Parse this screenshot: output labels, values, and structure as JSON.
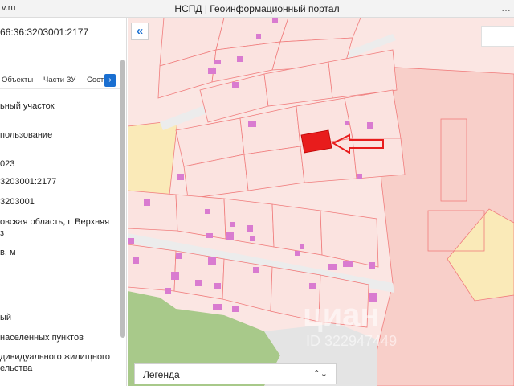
{
  "titlebar": {
    "url": "v.ru",
    "title": "НСПД | Геоинформационный портал"
  },
  "left_panel": {
    "cadastral_number": "66:36:3203001:2177",
    "tabs": [
      "Объекты",
      "Части ЗУ",
      "Соста"
    ],
    "lines": [
      "ьный участок",
      "пользование",
      "023",
      "3203001:2177",
      "3203001",
      "овская область, г. Верхняя",
      "з",
      "в. м",
      "ый",
      "населенных пунктов",
      "дивидуального жилищного",
      "ельства"
    ]
  },
  "map": {
    "collapse_label": "«",
    "legend_label": "Легенда",
    "legend_chevron": "⌃⌄",
    "watermark": "циан",
    "watermark_id": "ID 322947449"
  },
  "colors": {
    "parcel_fill": "#fbe3e0",
    "parcel_stroke": "#f07c7c",
    "selected": "#e81c1c",
    "building": "#d97bd0",
    "road": "#ececec",
    "green": "#a8c98a",
    "yellow_zone": "#faeab8",
    "accent": "#1a6fd1"
  }
}
